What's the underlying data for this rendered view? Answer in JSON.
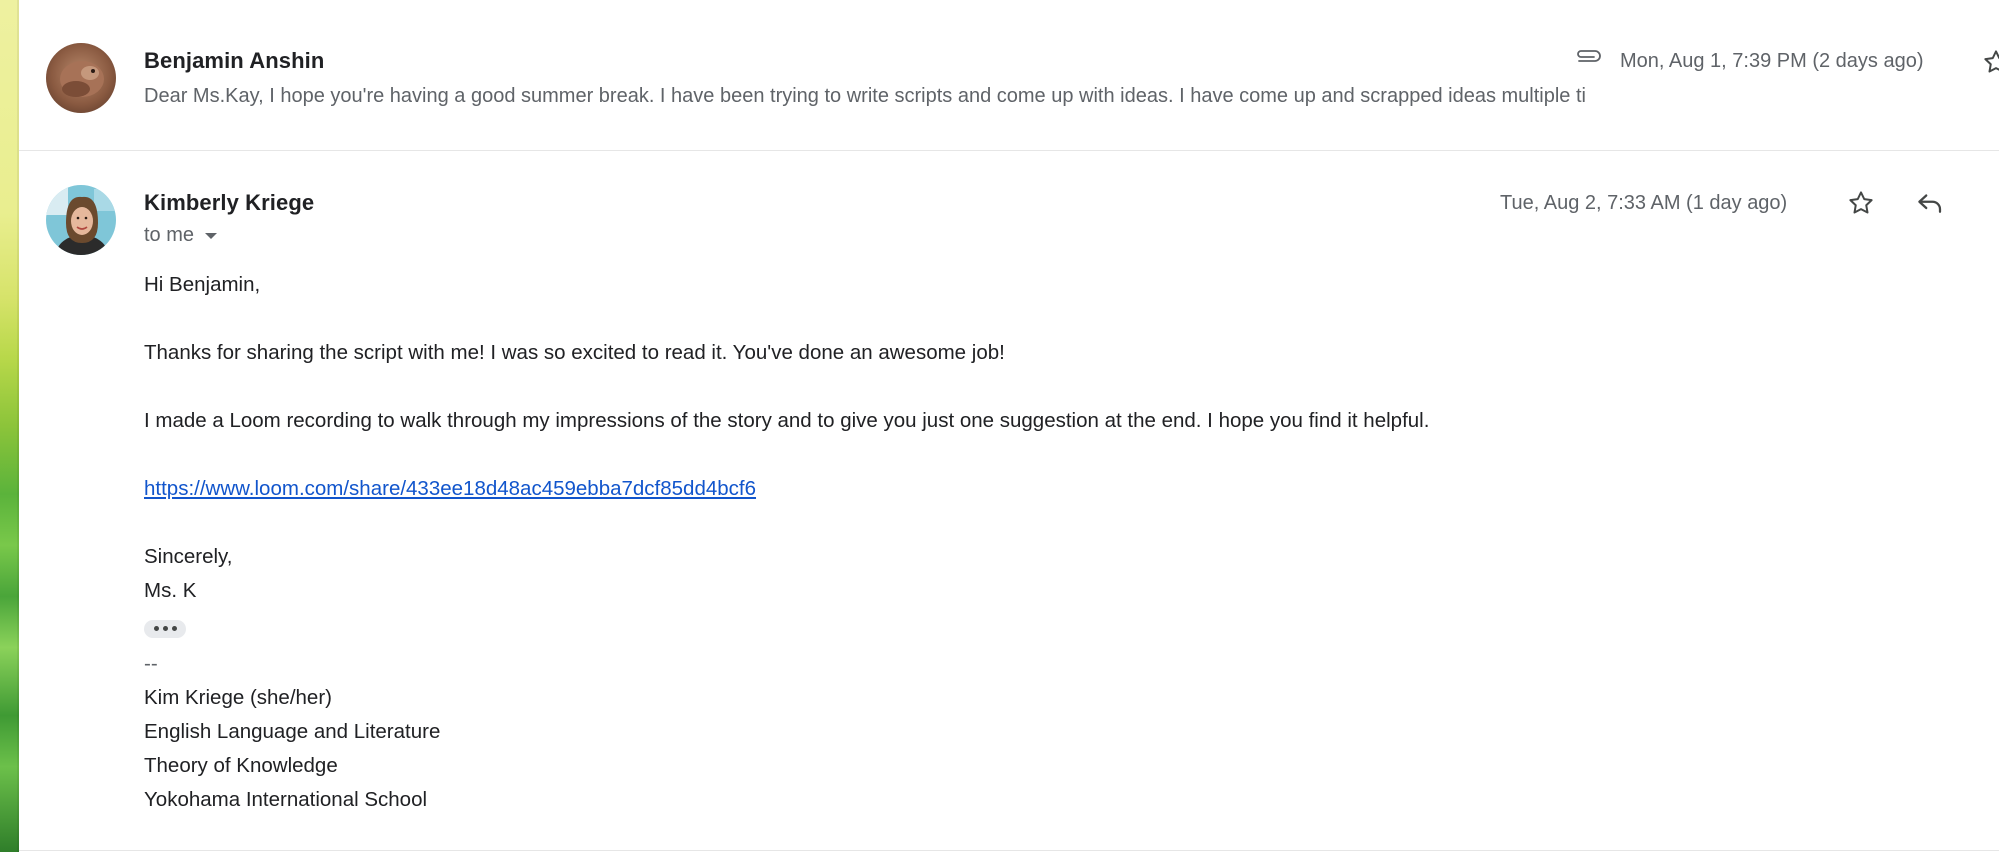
{
  "thread": {
    "messages": [
      {
        "sender": "Benjamin Anshin",
        "date": "Mon, Aug 1, 7:39 PM (2 days ago)",
        "has_attachment": true,
        "snippet": "Dear Ms.Kay, I hope you're having a good summer break. I have been trying to write scripts and come up with ideas. I have come up and scrapped ideas multiple ti"
      },
      {
        "sender": "Kimberly Kriege",
        "recipient_label": "to me",
        "date": "Tue, Aug 2, 7:33 AM (1 day ago)",
        "body": {
          "greeting": "Hi Benjamin,",
          "para1": "Thanks for sharing the script with me! I was so excited to read it. You've done an awesome job!",
          "para2": "I made a Loom recording to walk through my impressions of the story and to give you just one suggestion at the end. I hope you find it helpful.",
          "link": "https://www.loom.com/share/433ee18d48ac459ebba7dcf85dd4bcf6",
          "closing": "Sincerely,",
          "signoff": "Ms. K"
        },
        "signature": {
          "dash": "--",
          "name": "Kim Kriege (she/her)",
          "line1": "English Language and Literature",
          "line2": "Theory of Knowledge",
          "line3": "Yokohama International School"
        }
      }
    ]
  },
  "icons": {
    "attachment": "paperclip-icon",
    "star": "star-icon",
    "reply": "reply-icon",
    "more": "more-vert-icon",
    "dropdown": "caret-down-icon",
    "trimmed": "show-trimmed-content-icon"
  },
  "colors": {
    "link": "#1155cc",
    "muted_text": "#5f6368",
    "primary_text": "#202124"
  }
}
